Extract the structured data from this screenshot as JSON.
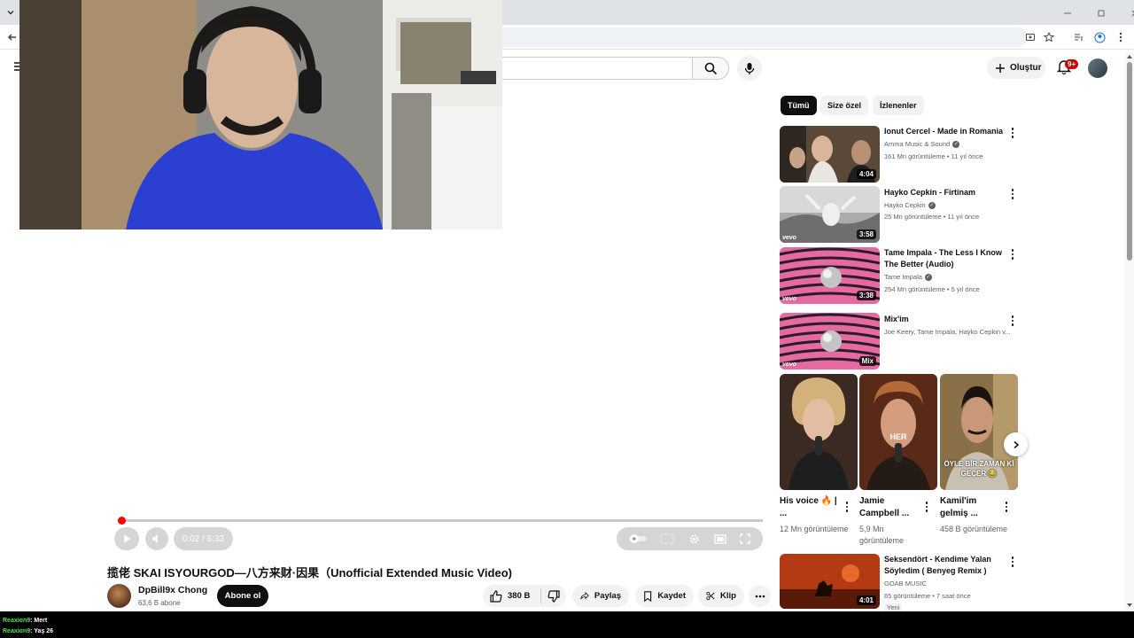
{
  "header": {
    "create_label": "Oluştur",
    "notification_count": "9+"
  },
  "player": {
    "time": "0:02 / 6:33",
    "progress_fraction": 0.005
  },
  "video": {
    "title": "揽佬 SKAI ISYOURGOD—八方来财·因果（Unofficial Extended Music Video)",
    "channel": "DpBill9x Chong",
    "subscribers": "63,6 B abone",
    "subscribe_label": "Abone ol",
    "likes": "380 B",
    "share_label": "Paylaş",
    "save_label": "Kaydet",
    "clip_label": "Klip"
  },
  "sidebar": {
    "chips": [
      "Tümü",
      "Size özel",
      "İzlenenler"
    ],
    "recommendations": [
      {
        "title": "Ionut Cercel - Made in Romania",
        "channel": "Amma Music & Sound",
        "verified": true,
        "meta": "161 Mn görüntüleme • 11 yıl önce",
        "duration": "4:04",
        "vevo": false
      },
      {
        "title": "Hayko Cepkin - Firtinam",
        "channel": "Hayko Cepkin",
        "verified": true,
        "meta": "25 Mn görüntüleme • 11 yıl önce",
        "duration": "3:58",
        "vevo": true
      },
      {
        "title": "Tame Impala - The Less I Know The Better (Audio)",
        "channel": "Tame Impala",
        "verified": true,
        "meta": "254 Mn görüntüleme • 5 yıl önce",
        "duration": "3:38",
        "vevo": true
      },
      {
        "title": "Mix'im",
        "channel": "Joe Keery, Tame Impala, Hayko Cepkin v...",
        "verified": false,
        "meta": "",
        "duration": "Mix",
        "vevo": true
      }
    ],
    "shorts": [
      {
        "title": "His voice 🔥 | ...",
        "views": "12 Mn görüntüleme",
        "overlay": ""
      },
      {
        "title": "Jamie Campbell ...",
        "views": "5,9 Mn görüntüleme",
        "overlay": "HER"
      },
      {
        "title": "Kamil'im gelmiş ...",
        "views": "458 B görüntüleme",
        "overlay": "ÖYLE BİR ZAMAN Kİ GEÇER 😂"
      }
    ],
    "last_recommendation": {
      "title": "Seksendört - Kendime Yalan Söyledim ( Benyeg Remix )",
      "channel": "GOAB MUSIC",
      "meta": "65 görüntüleme • 7 saat önce",
      "badge": "Yeni",
      "duration": "4:01"
    }
  },
  "chat": {
    "lines": [
      {
        "user": "Reaxion9",
        "message": ": Mert"
      },
      {
        "user": "Reaxion9",
        "message": ": Yaş 26"
      }
    ]
  },
  "colors": {
    "accent_red": "#ff0000",
    "chip_active": "#0f0f0f",
    "secondary_text": "#606060"
  }
}
